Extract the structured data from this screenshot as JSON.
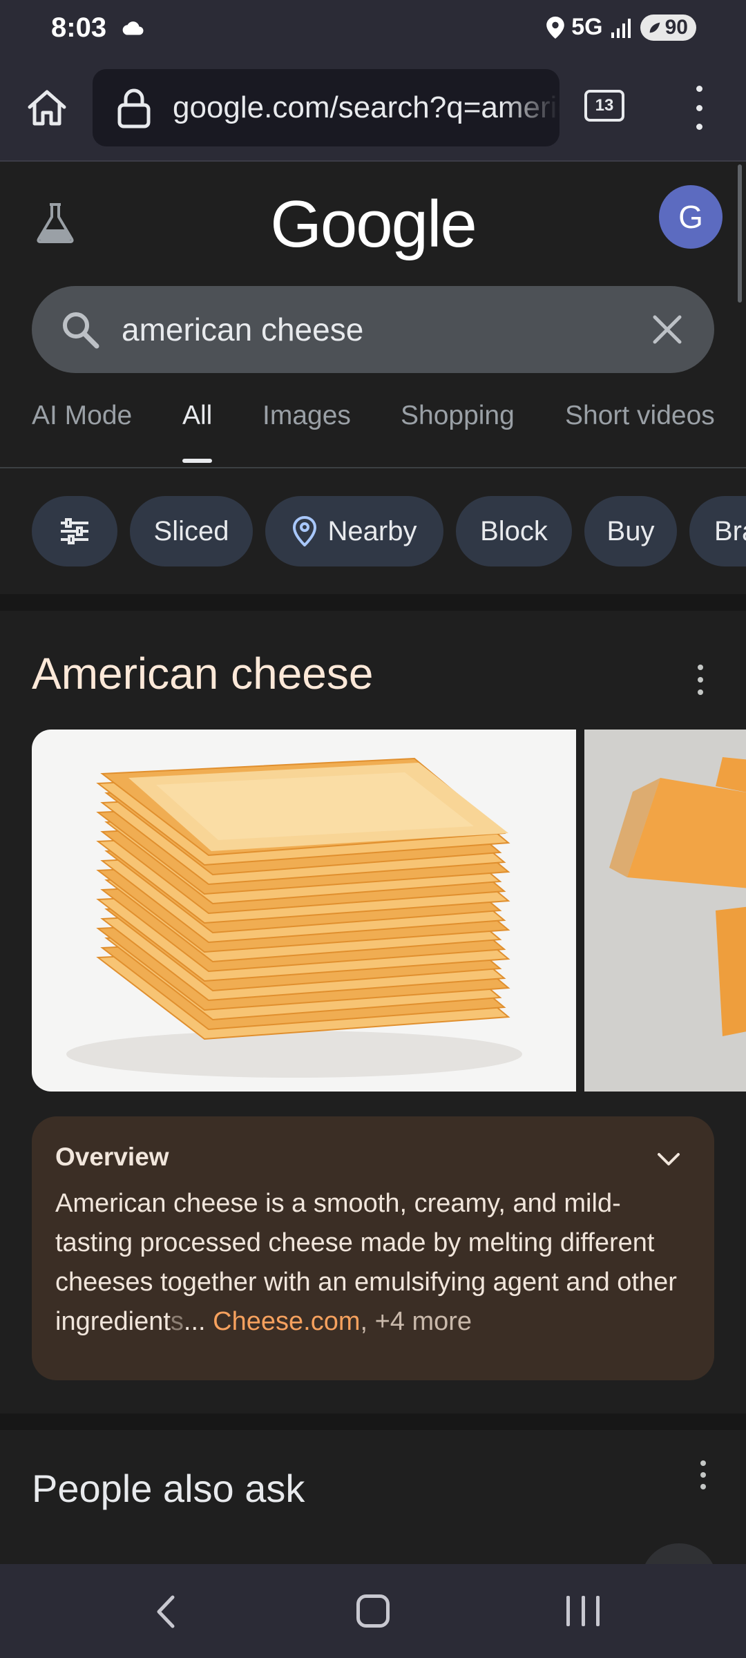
{
  "status_bar": {
    "time": "8:03",
    "network": "5G",
    "battery": "90"
  },
  "browser": {
    "url": "google.com/search?q=american+cheese",
    "tab_count": "13"
  },
  "google": {
    "logo": "Google",
    "avatar_letter": "G",
    "search_query": "american cheese"
  },
  "tabs": [
    {
      "label": "AI Mode"
    },
    {
      "label": "All",
      "active": true
    },
    {
      "label": "Images"
    },
    {
      "label": "Shopping"
    },
    {
      "label": "Short videos"
    }
  ],
  "chips": [
    {
      "label": "Sliced"
    },
    {
      "label": "Nearby"
    },
    {
      "label": "Block"
    },
    {
      "label": "Buy"
    },
    {
      "label": "Bra"
    }
  ],
  "knowledge_panel": {
    "title": "American cheese",
    "overview": {
      "heading": "Overview",
      "text": "American cheese is a smooth, creamy, and mild-tasting processed cheese made by melting different cheeses together with an emulsifying agent and other ingredient",
      "fade_text": "s",
      "ellipsis": "...",
      "source": "Cheese.com",
      "more": ", +4 more"
    }
  },
  "people_also_ask": {
    "title": "People also ask"
  },
  "colors": {
    "accent_source": "#f6a15e",
    "overview_bg": "#3b2e25",
    "avatar_bg": "#5c6bc0",
    "chip_bg": "#303846"
  }
}
